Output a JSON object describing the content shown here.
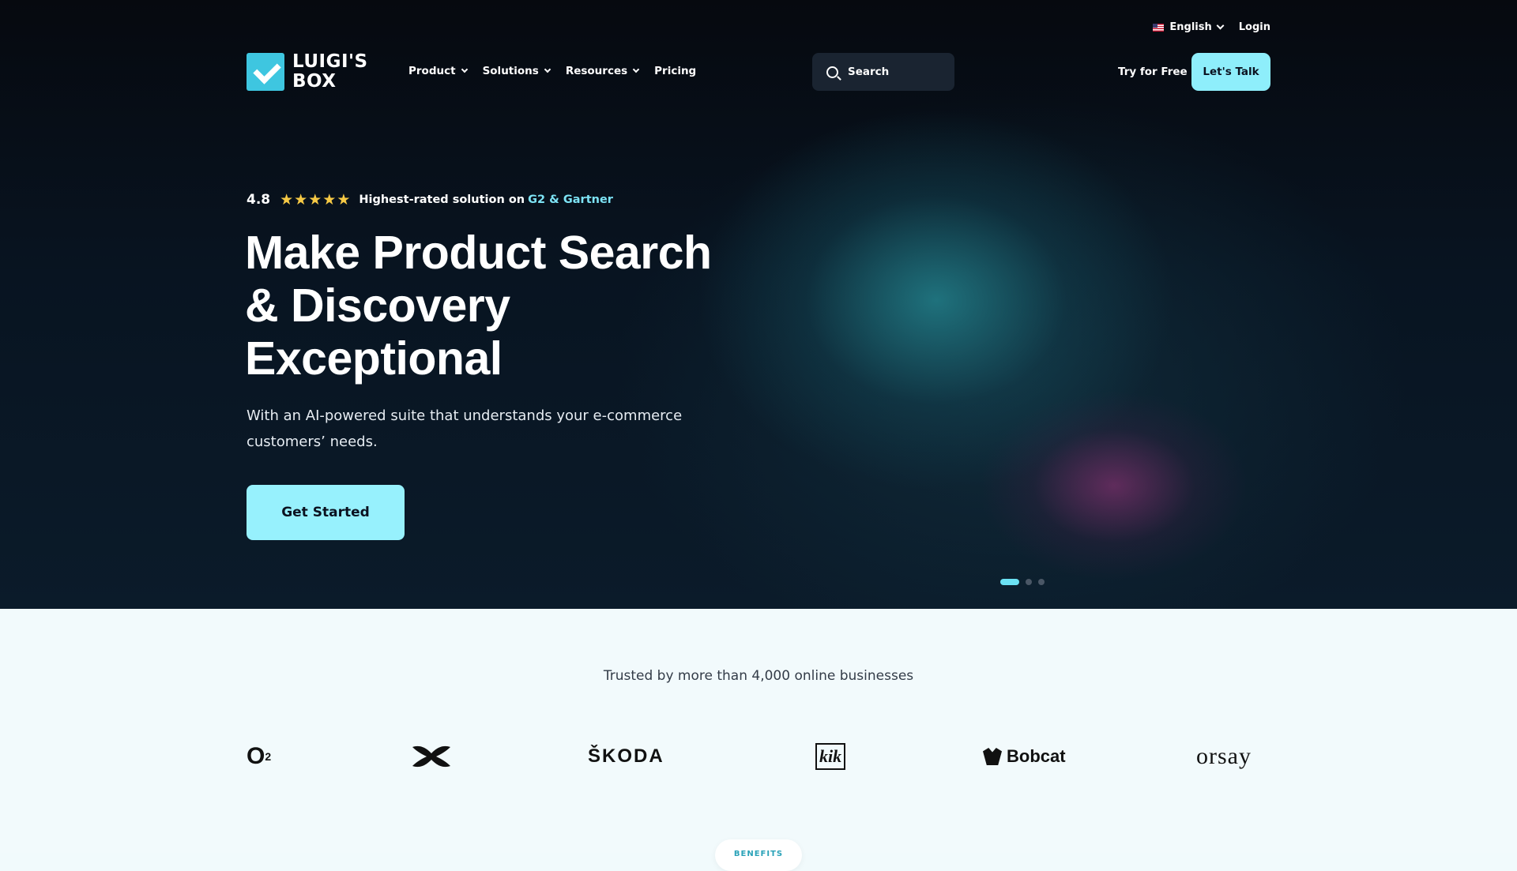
{
  "header": {
    "language": {
      "label": "English",
      "flag_icon": "us-flag-icon"
    },
    "login_label": "Login",
    "logo": {
      "line1": "LUIGI'S",
      "line2": "BOX"
    },
    "nav": [
      {
        "label": "Product",
        "has_dropdown": true
      },
      {
        "label": "Solutions",
        "has_dropdown": true
      },
      {
        "label": "Resources",
        "has_dropdown": true
      },
      {
        "label": "Pricing",
        "has_dropdown": false
      }
    ],
    "search_placeholder": "Search",
    "try_free_label": "Try for Free",
    "lets_talk_label": "Let's Talk"
  },
  "hero": {
    "rating": {
      "score": "4.8",
      "stars": 5,
      "text": "Highest-rated solution on",
      "link": "G2 & Gartner"
    },
    "headline_lines": [
      "Make Product Search",
      "& Discovery",
      "Exceptional"
    ],
    "subheading": "With an AI-powered suite that understands your e-commerce customers’ needs.",
    "cta_label": "Get Started",
    "carousel": {
      "total": 3,
      "active": 1
    }
  },
  "trust": {
    "title": "Trusted by more than 4,000 online businesses",
    "brands": [
      "O2",
      "Under Armour",
      "ŠKODA",
      "kik",
      "Bobcat",
      "orsay"
    ],
    "brand_text": {
      "o2": "O",
      "o2_sub": "2",
      "skoda": "ŠKODA",
      "kik": "kik",
      "bobcat": "Bobcat",
      "orsay": "orsay"
    }
  },
  "benefits_label": "BENEFITS",
  "colors": {
    "accent": "#97f1fd",
    "link": "#7de3f5",
    "star": "#f6c945",
    "hero_bg": "#081421",
    "trust_bg": "#f2fafc"
  }
}
